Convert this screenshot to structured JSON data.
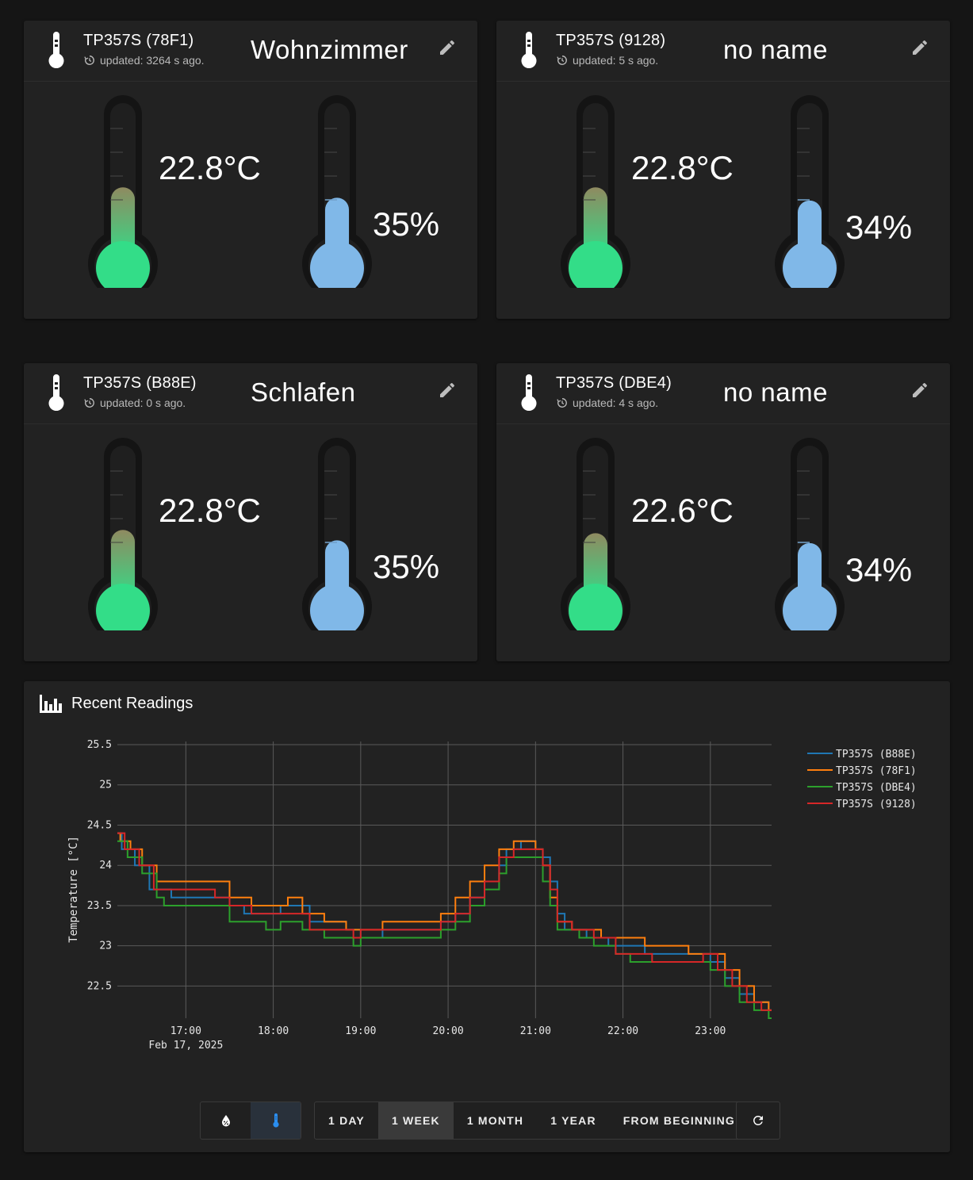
{
  "sensors": [
    {
      "id": "TP357S (78F1)",
      "updated": "updated: 3264 s ago.",
      "name": "Wohnzimmer",
      "temperature": "22.8°C",
      "humidity": "35%",
      "temp_level": 0.22,
      "hum_level": 0.22
    },
    {
      "id": "TP357S (9128)",
      "updated": "updated: 5 s ago.",
      "name": "no name",
      "temperature": "22.8°C",
      "humidity": "34%",
      "temp_level": 0.22,
      "hum_level": 0.21
    },
    {
      "id": "TP357S (B88E)",
      "updated": "updated: 0 s ago.",
      "name": "Schlafen",
      "temperature": "22.8°C",
      "humidity": "35%",
      "temp_level": 0.22,
      "hum_level": 0.22
    },
    {
      "id": "TP357S (DBE4)",
      "updated": "updated: 4 s ago.",
      "name": "no name",
      "temperature": "22.6°C",
      "humidity": "34%",
      "temp_level": 0.21,
      "hum_level": 0.21
    }
  ],
  "icons": {
    "sensor": "thermometer-icon",
    "updated": "history-icon",
    "edit": "pencil-icon",
    "chart": "bar-chart-icon",
    "humidity_toggle": "water-percent-icon",
    "temperature_toggle": "thermometer-icon",
    "refresh": "refresh-icon"
  },
  "colors": {
    "temp_fill": "#33dd88",
    "temp_fill_top": "#8f8a60",
    "hum_fill": "#80b8e8",
    "card_bg": "#222222",
    "page_bg": "#151515"
  },
  "chart_card": {
    "title": "Recent Readings"
  },
  "range_buttons": {
    "day": "1 DAY",
    "week": "1 WEEK",
    "month": "1 MONTH",
    "year": "1 YEAR",
    "all": "FROM BEGINNING",
    "active": "1 WEEK"
  },
  "chart_data": {
    "type": "line",
    "ylabel": "Temperature [°C]",
    "xlabel": "",
    "x_ticks": [
      "17:00",
      "18:00",
      "19:00",
      "20:00",
      "21:00",
      "22:00",
      "23:00"
    ],
    "x_date_label": "Feb 17, 2025",
    "x_range": [
      "16:13",
      "23:42"
    ],
    "y_ticks": [
      22.5,
      23,
      23.5,
      24,
      24.5,
      25,
      25.5
    ],
    "ylim": [
      22.1,
      25.5
    ],
    "grid": true,
    "legend": "right",
    "series": [
      {
        "name": "TP357S (B88E)",
        "color": "#1f77b4",
        "points": [
          [
            "16:13",
            24.4
          ],
          [
            "16:16",
            24.2
          ],
          [
            "16:25",
            24.0
          ],
          [
            "16:35",
            23.7
          ],
          [
            "16:45",
            23.7
          ],
          [
            "16:50",
            23.6
          ],
          [
            "17:05",
            23.6
          ],
          [
            "17:20",
            23.6
          ],
          [
            "17:30",
            23.5
          ],
          [
            "17:40",
            23.4
          ],
          [
            "17:55",
            23.4
          ],
          [
            "18:05",
            23.5
          ],
          [
            "18:15",
            23.5
          ],
          [
            "18:25",
            23.3
          ],
          [
            "18:35",
            23.3
          ],
          [
            "18:50",
            23.2
          ],
          [
            "19:00",
            23.1
          ],
          [
            "19:15",
            23.2
          ],
          [
            "19:30",
            23.2
          ],
          [
            "19:50",
            23.2
          ],
          [
            "19:55",
            23.3
          ],
          [
            "20:05",
            23.4
          ],
          [
            "20:15",
            23.6
          ],
          [
            "20:25",
            23.8
          ],
          [
            "20:35",
            24.0
          ],
          [
            "20:40",
            24.2
          ],
          [
            "20:50",
            24.3
          ],
          [
            "21:00",
            24.2
          ],
          [
            "21:05",
            24.1
          ],
          [
            "21:10",
            23.8
          ],
          [
            "21:15",
            23.4
          ],
          [
            "21:20",
            23.2
          ],
          [
            "21:35",
            23.1
          ],
          [
            "21:50",
            23.0
          ],
          [
            "22:05",
            23.0
          ],
          [
            "22:15",
            22.9
          ],
          [
            "22:45",
            22.9
          ],
          [
            "23:00",
            22.8
          ],
          [
            "23:10",
            22.6
          ],
          [
            "23:20",
            22.4
          ],
          [
            "23:30",
            22.3
          ],
          [
            "23:40",
            22.2
          ]
        ]
      },
      {
        "name": "TP357S (78F1)",
        "color": "#ff7f0e",
        "points": [
          [
            "16:13",
            24.4
          ],
          [
            "16:15",
            24.3
          ],
          [
            "16:22",
            24.2
          ],
          [
            "16:30",
            24.0
          ],
          [
            "16:40",
            23.8
          ],
          [
            "16:50",
            23.8
          ],
          [
            "17:05",
            23.8
          ],
          [
            "17:20",
            23.8
          ],
          [
            "17:30",
            23.6
          ],
          [
            "17:45",
            23.5
          ],
          [
            "18:00",
            23.5
          ],
          [
            "18:10",
            23.6
          ],
          [
            "18:20",
            23.4
          ],
          [
            "18:35",
            23.3
          ],
          [
            "18:50",
            23.2
          ],
          [
            "19:00",
            23.2
          ],
          [
            "19:15",
            23.3
          ],
          [
            "19:30",
            23.3
          ],
          [
            "19:50",
            23.3
          ],
          [
            "19:55",
            23.4
          ],
          [
            "20:05",
            23.6
          ],
          [
            "20:15",
            23.8
          ],
          [
            "20:25",
            24.0
          ],
          [
            "20:35",
            24.2
          ],
          [
            "20:45",
            24.3
          ],
          [
            "21:00",
            24.2
          ],
          [
            "21:05",
            24.0
          ],
          [
            "21:10",
            23.6
          ],
          [
            "21:15",
            23.3
          ],
          [
            "21:25",
            23.2
          ],
          [
            "21:45",
            23.1
          ],
          [
            "22:05",
            23.1
          ],
          [
            "22:15",
            23.0
          ],
          [
            "22:35",
            23.0
          ],
          [
            "22:45",
            22.9
          ],
          [
            "23:00",
            22.9
          ],
          [
            "23:10",
            22.7
          ],
          [
            "23:20",
            22.5
          ],
          [
            "23:30",
            22.3
          ],
          [
            "23:40",
            22.2
          ]
        ]
      },
      {
        "name": "TP357S (DBE4)",
        "color": "#2ca02c",
        "points": [
          [
            "16:13",
            24.3
          ],
          [
            "16:20",
            24.1
          ],
          [
            "16:30",
            23.9
          ],
          [
            "16:40",
            23.6
          ],
          [
            "16:45",
            23.5
          ],
          [
            "17:05",
            23.5
          ],
          [
            "17:20",
            23.5
          ],
          [
            "17:30",
            23.3
          ],
          [
            "17:50",
            23.3
          ],
          [
            "17:55",
            23.2
          ],
          [
            "18:05",
            23.3
          ],
          [
            "18:20",
            23.2
          ],
          [
            "18:35",
            23.1
          ],
          [
            "18:55",
            23.0
          ],
          [
            "19:00",
            23.1
          ],
          [
            "19:15",
            23.1
          ],
          [
            "19:30",
            23.1
          ],
          [
            "19:50",
            23.1
          ],
          [
            "19:55",
            23.2
          ],
          [
            "20:05",
            23.3
          ],
          [
            "20:15",
            23.5
          ],
          [
            "20:25",
            23.7
          ],
          [
            "20:35",
            23.9
          ],
          [
            "20:40",
            24.1
          ],
          [
            "20:50",
            24.1
          ],
          [
            "21:00",
            24.1
          ],
          [
            "21:05",
            23.8
          ],
          [
            "21:10",
            23.5
          ],
          [
            "21:15",
            23.2
          ],
          [
            "21:30",
            23.1
          ],
          [
            "21:40",
            23.0
          ],
          [
            "21:55",
            22.9
          ],
          [
            "22:05",
            22.8
          ],
          [
            "22:20",
            22.8
          ],
          [
            "22:45",
            22.8
          ],
          [
            "22:55",
            22.8
          ],
          [
            "23:00",
            22.7
          ],
          [
            "23:10",
            22.5
          ],
          [
            "23:20",
            22.3
          ],
          [
            "23:30",
            22.2
          ],
          [
            "23:40",
            22.1
          ]
        ]
      },
      {
        "name": "TP357S (9128)",
        "color": "#d62728",
        "points": [
          [
            "16:13",
            24.4
          ],
          [
            "16:18",
            24.2
          ],
          [
            "16:28",
            24.0
          ],
          [
            "16:38",
            23.7
          ],
          [
            "16:50",
            23.7
          ],
          [
            "17:05",
            23.7
          ],
          [
            "17:20",
            23.6
          ],
          [
            "17:30",
            23.5
          ],
          [
            "17:45",
            23.4
          ],
          [
            "17:55",
            23.4
          ],
          [
            "18:05",
            23.4
          ],
          [
            "18:15",
            23.4
          ],
          [
            "18:25",
            23.2
          ],
          [
            "18:35",
            23.2
          ],
          [
            "18:55",
            23.1
          ],
          [
            "19:00",
            23.2
          ],
          [
            "19:15",
            23.2
          ],
          [
            "19:30",
            23.2
          ],
          [
            "19:50",
            23.2
          ],
          [
            "19:55",
            23.3
          ],
          [
            "20:05",
            23.4
          ],
          [
            "20:15",
            23.6
          ],
          [
            "20:25",
            23.8
          ],
          [
            "20:35",
            24.1
          ],
          [
            "20:45",
            24.2
          ],
          [
            "21:00",
            24.2
          ],
          [
            "21:05",
            24.0
          ],
          [
            "21:10",
            23.7
          ],
          [
            "21:15",
            23.3
          ],
          [
            "21:25",
            23.2
          ],
          [
            "21:40",
            23.1
          ],
          [
            "21:55",
            22.9
          ],
          [
            "22:05",
            22.9
          ],
          [
            "22:20",
            22.8
          ],
          [
            "22:45",
            22.8
          ],
          [
            "22:55",
            22.9
          ],
          [
            "23:05",
            22.7
          ],
          [
            "23:15",
            22.5
          ],
          [
            "23:25",
            22.3
          ],
          [
            "23:35",
            22.2
          ],
          [
            "23:40",
            22.2
          ]
        ]
      }
    ]
  }
}
